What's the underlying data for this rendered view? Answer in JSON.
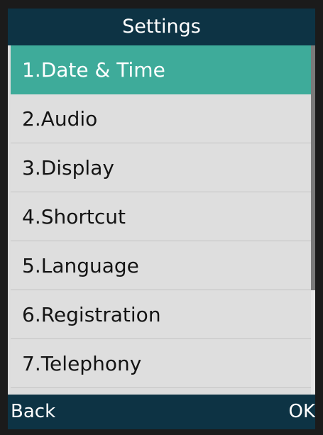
{
  "header": {
    "title": "Settings"
  },
  "menu": {
    "items": [
      {
        "label": "1.Date & Time"
      },
      {
        "label": "2.Audio"
      },
      {
        "label": "3.Display"
      },
      {
        "label": "4.Shortcut"
      },
      {
        "label": "5.Language"
      },
      {
        "label": "6.Registration"
      },
      {
        "label": "7.Telephony"
      }
    ],
    "selected_index": 0
  },
  "softkeys": {
    "left": "Back",
    "right": "OK"
  },
  "colors": {
    "title_bar": "#0d3344",
    "selection": "#3eab9a",
    "list_background": "#dedede"
  }
}
